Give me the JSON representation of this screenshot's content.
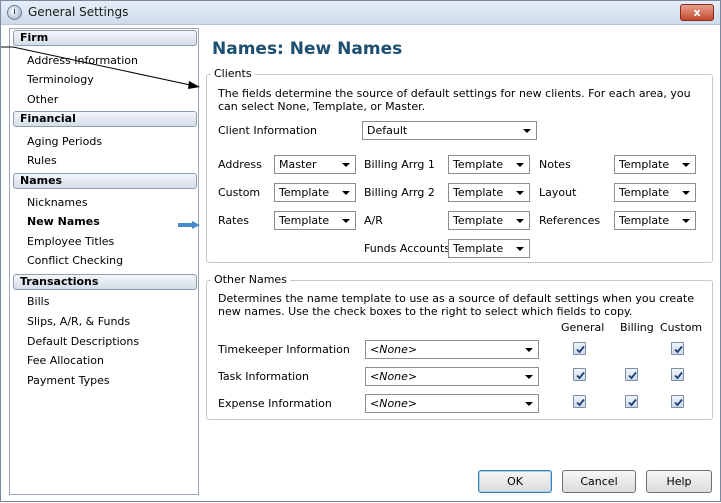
{
  "window": {
    "title": "General Settings",
    "close_label": "x"
  },
  "sidebar": {
    "groups": [
      {
        "label": "Firm",
        "items": [
          "Address Information",
          "Terminology",
          "Other"
        ]
      },
      {
        "label": "Financial",
        "items": [
          "Aging Periods",
          "Rules"
        ]
      },
      {
        "label": "Names",
        "items": [
          "Nicknames",
          "New Names",
          "Employee Titles",
          "Conflict Checking"
        ]
      },
      {
        "label": "Transactions",
        "items": [
          "Bills",
          "Slips, A/R, & Funds",
          "Default Descriptions",
          "Fee Allocation",
          "Payment Types"
        ]
      }
    ],
    "active_item": "New Names"
  },
  "page_title": "Names: New Names",
  "clients": {
    "legend": "Clients",
    "description": "The fields determine the source of default settings for new clients. For each area, you can select None, Template, or Master.",
    "client_information": {
      "label": "Client Information",
      "value": "Default"
    },
    "fields": {
      "address": {
        "label": "Address",
        "value": "Master"
      },
      "custom": {
        "label": "Custom",
        "value": "Template"
      },
      "rates": {
        "label": "Rates",
        "value": "Template"
      },
      "billing_arrg_1": {
        "label": "Billing Arrg 1",
        "value": "Template"
      },
      "billing_arrg_2": {
        "label": "Billing Arrg 2",
        "value": "Template"
      },
      "ar": {
        "label": "A/R",
        "value": "Template"
      },
      "funds_accounts": {
        "label": "Funds Accounts",
        "value": "Template"
      },
      "notes": {
        "label": "Notes",
        "value": "Template"
      },
      "layout": {
        "label": "Layout",
        "value": "Template"
      },
      "references": {
        "label": "References",
        "value": "Template"
      }
    }
  },
  "other_names": {
    "legend": "Other Names",
    "description": "Determines the name template to use as a source of default settings when you create new names. Use the check boxes to the right to select which fields to copy.",
    "columns": {
      "general": "General",
      "billing": "Billing",
      "custom": "Custom"
    },
    "rows": {
      "timekeeper": {
        "label": "Timekeeper Information",
        "value": "<None>"
      },
      "task": {
        "label": "Task Information",
        "value": "<None>"
      },
      "expense": {
        "label": "Expense Information",
        "value": "<None>"
      }
    }
  },
  "buttons": {
    "ok": "OK",
    "cancel": "Cancel",
    "help": "Help"
  }
}
